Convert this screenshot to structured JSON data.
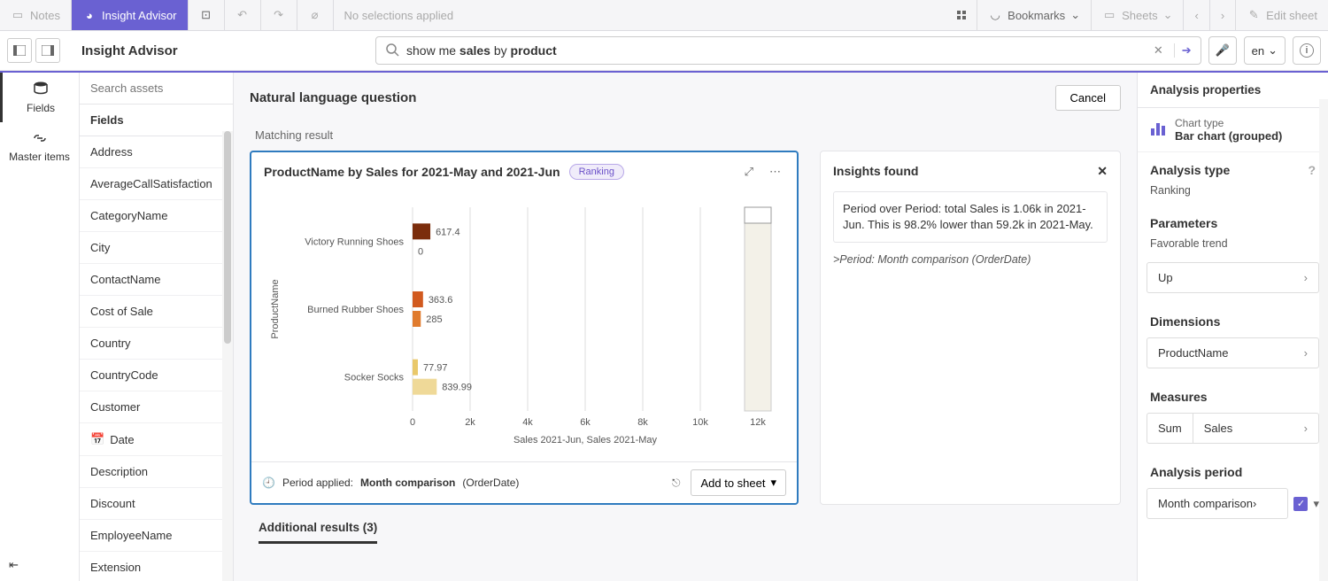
{
  "toolbar": {
    "notes": "Notes",
    "insight_advisor": "Insight Advisor",
    "no_selections": "No selections applied",
    "bookmarks": "Bookmarks",
    "sheets": "Sheets",
    "edit_sheet": "Edit sheet"
  },
  "second_bar": {
    "title": "Insight Advisor",
    "search_prefix": "show me ",
    "search_bold1": "sales",
    "search_mid": " by ",
    "search_bold2": "product",
    "lang": "en"
  },
  "left_tabs": {
    "fields": "Fields",
    "master_items": "Master items"
  },
  "fields": {
    "search_placeholder": "Search assets",
    "header": "Fields",
    "items": [
      "Address",
      "AverageCallSatisfaction",
      "CategoryName",
      "City",
      "ContactName",
      "Cost of Sale",
      "Country",
      "CountryCode",
      "Customer",
      "Date",
      "Description",
      "Discount",
      "EmployeeName",
      "Extension"
    ]
  },
  "center": {
    "nlq": "Natural language question",
    "cancel": "Cancel",
    "matching": "Matching result",
    "chart_title": "ProductName by Sales for 2021-May and 2021-Jun",
    "badge": "Ranking",
    "period_label": "Period applied:",
    "period_value": "Month comparison",
    "period_suffix": "(OrderDate)",
    "add_to_sheet": "Add to sheet",
    "additional": "Additional results (3)"
  },
  "insights": {
    "title": "Insights found",
    "text": "Period over Period: total Sales is 1.06k in 2021-Jun. This is 98.2% lower than 59.2k in 2021-May.",
    "note": ">Period: Month comparison (OrderDate)"
  },
  "right": {
    "title": "Analysis properties",
    "chart_type_label": "Chart type",
    "chart_type_value": "Bar chart (grouped)",
    "analysis_type": "Analysis type",
    "analysis_type_value": "Ranking",
    "parameters": "Parameters",
    "fav_trend": "Favorable trend",
    "fav_trend_value": "Up",
    "dimensions": "Dimensions",
    "dimension_value": "ProductName",
    "measures": "Measures",
    "measure_agg": "Sum",
    "measure_field": "Sales",
    "analysis_period": "Analysis period",
    "period_value": "Month comparison"
  },
  "chart_data": {
    "type": "bar",
    "title": "ProductName by Sales for 2021-May and 2021-Jun",
    "ylabel": "ProductName",
    "xlabel": "Sales 2021-Jun, Sales 2021-May",
    "xlim": [
      0,
      12000
    ],
    "xticks": [
      0,
      2000,
      4000,
      6000,
      8000,
      10000,
      12000
    ],
    "xtick_labels": [
      "0",
      "2k",
      "4k",
      "6k",
      "8k",
      "10k",
      "12k"
    ],
    "categories": [
      "Victory Running Shoes",
      "Burned Rubber Shoes",
      "Socker Socks"
    ],
    "series": [
      {
        "name": "2021-Jun",
        "color": "#8b3a0e",
        "values": [
          617.4,
          363.6,
          77.97
        ]
      },
      {
        "name": "2021-May",
        "color": "#e8931c",
        "values": [
          0,
          285,
          839.99
        ]
      }
    ]
  }
}
